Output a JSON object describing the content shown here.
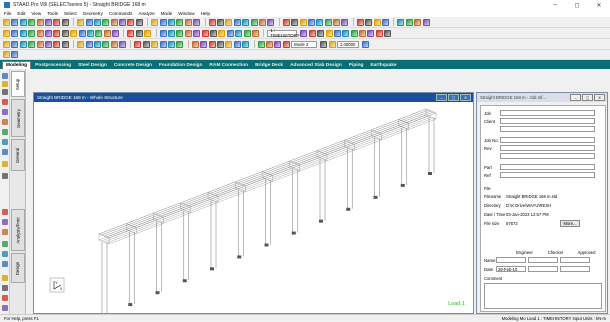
{
  "window": {
    "title": "STAAD.Pro V8i (SELECTseries 5) - Straight BRIDGE 168 m"
  },
  "menu": [
    "File",
    "Edit",
    "View",
    "Tools",
    "Select",
    "Geometry",
    "Commands",
    "Analyze",
    "Mode",
    "Window",
    "Help"
  ],
  "toolbar": {
    "view_select": "1 : TIMEHISTORY",
    "mode_select": "Mode 2",
    "scale_value": "1.00000"
  },
  "workflow_tabs": [
    "Modeling",
    "Postprocessing",
    "Steel Design",
    "Concrete Design",
    "Foundation Design",
    "RAM Connection",
    "Bridge Deck",
    "Advanced Slab Design",
    "Piping",
    "Earthquake"
  ],
  "workflow_active": "Modeling",
  "side_tabs": [
    "Setup",
    "Geometry",
    "General",
    "Analysis/Print",
    "Design"
  ],
  "viewport": {
    "title": "Straight BRIDGE 168 m - Whole Structure",
    "load_label": "Load 1",
    "axis_y": "Y",
    "axis_x": "X"
  },
  "page_control": {
    "title": "Straight BRIDGE 168 m - Job Inf...",
    "fields": [
      "Job",
      "Client",
      "",
      "Job No.",
      "Rev",
      "",
      "Part",
      "Ref"
    ],
    "file_label": "File",
    "info": [
      {
        "k": "Filename",
        "v": "Straight BRIDGE 168 m.std"
      },
      {
        "k": "Directory",
        "v": "D:\\K Drive\\WAYU\\RESH"
      },
      {
        "k": "Date / Time",
        "v": "03-Jan-2023    12:57 PM"
      },
      {
        "k": "File size",
        "v": "57672"
      }
    ],
    "more_label": "More...",
    "roles": [
      "Engineer",
      "Checker",
      "Approved"
    ],
    "name_label": "Name",
    "date_label": "Date",
    "date_value": "26-Feb-10",
    "comment_label": "Comment"
  },
  "status": {
    "left": "For Help, press F1",
    "right": "Modeling Mo  Load 1 : TIMEHISTORY      Input Units : kN-m"
  },
  "colors": {
    "workflow_bar": "#0a6e76",
    "workflow_text": "#d8f5e4",
    "viewport_title": "#1b4f9c",
    "load_label": "#1fbf1f",
    "structure": "#8a8a8a",
    "supports": "#555555"
  }
}
